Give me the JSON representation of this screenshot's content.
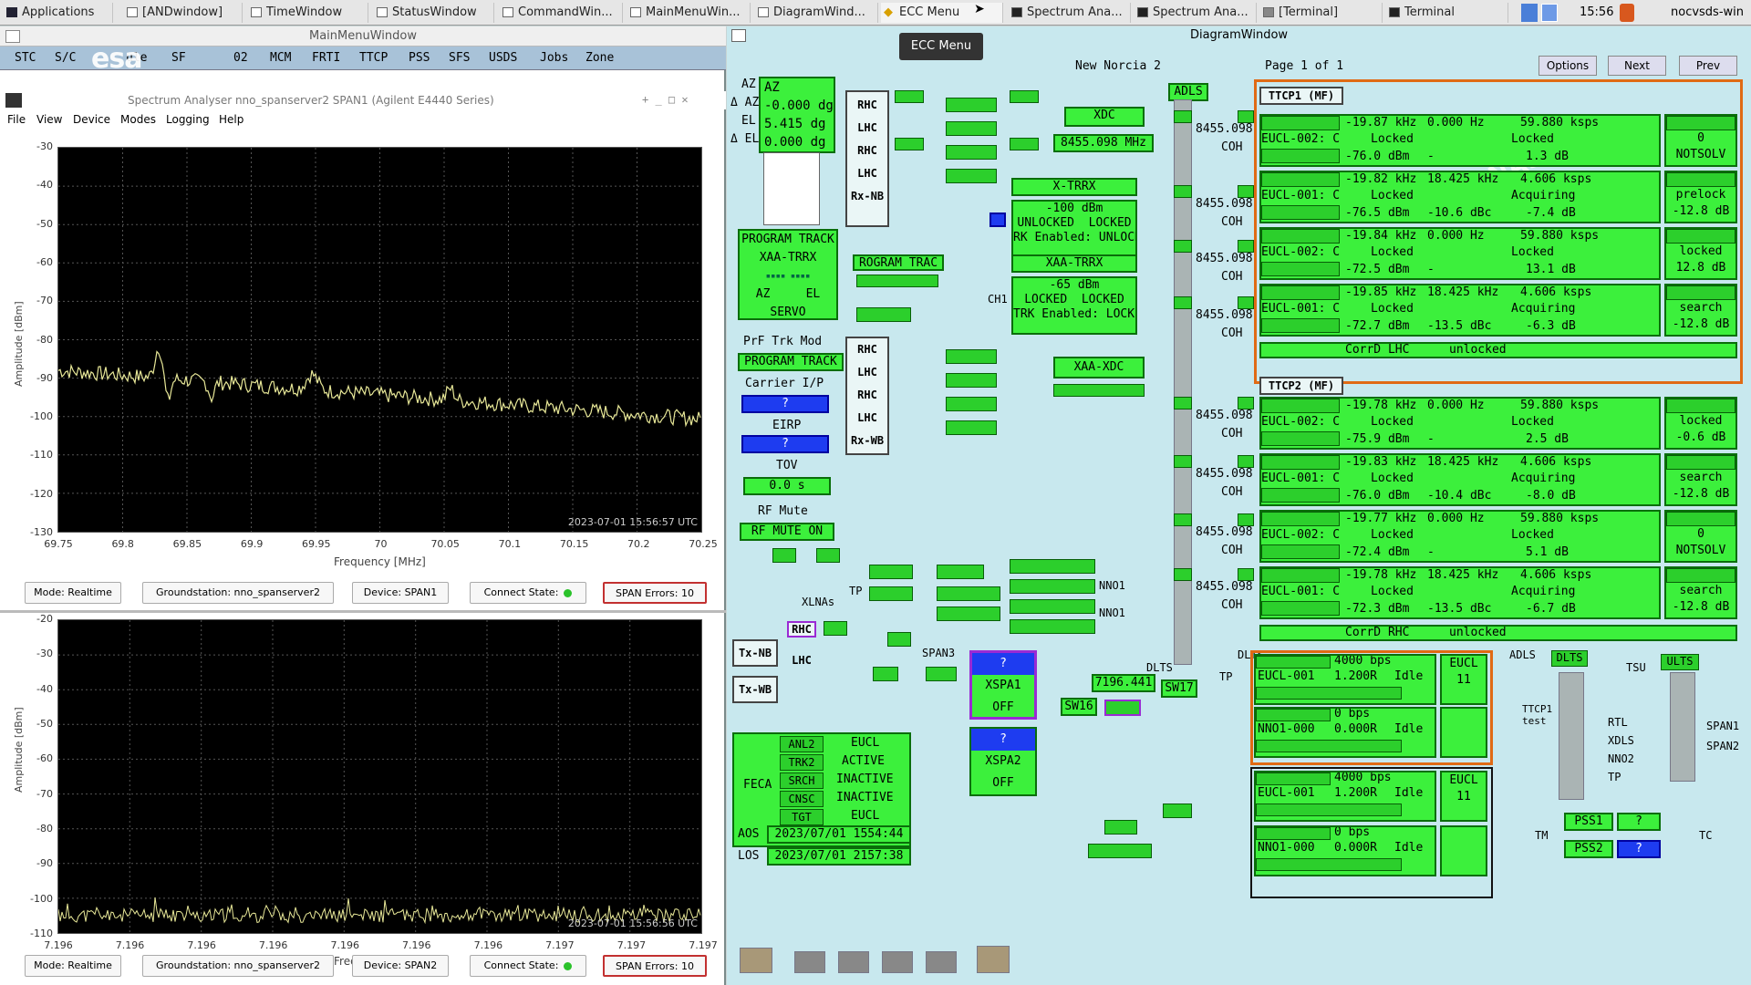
{
  "taskbar": {
    "items": [
      "Applications",
      "[ANDwindow]",
      "TimeWindow",
      "StatusWindow",
      "CommandWin...",
      "MainMenuWin...",
      "DiagramWind...",
      "ECC Menu",
      "Spectrum Ana...",
      "Spectrum Ana...",
      "[Terminal]",
      "Terminal"
    ],
    "clock": "15:56",
    "host": "nocvsds-win",
    "tooltip": "ECC Menu"
  },
  "mainmenu": {
    "title": "MainMenuWindow",
    "items": [
      "STC",
      "S/C",
      "ule",
      "SF",
      "02",
      "MCM",
      "FRTI",
      "TTCP",
      "PSS",
      "SFS",
      "USDS",
      "Jobs",
      "Zone"
    ],
    "logo": "esa"
  },
  "spectrum": {
    "title": "Spectrum Analyser nno_spanserver2 SPAN1 (Agilent E4440 Series)",
    "menu": [
      "File",
      "View",
      "Device",
      "Modes",
      "Logging",
      "Help"
    ],
    "plot1": {
      "ylabel": "Amplitude [dBm]",
      "yticks": [
        "-30",
        "-40",
        "-50",
        "-60",
        "-70",
        "-80",
        "-90",
        "-100",
        "-110",
        "-120",
        "-130"
      ],
      "xticks": [
        "69.75",
        "69.8",
        "69.85",
        "69.9",
        "69.95",
        "70",
        "70.05",
        "70.1",
        "70.15",
        "70.2",
        "70.25"
      ],
      "xlabel": "Frequency [MHz]",
      "timestamp": "2023-07-01 15:56:57 UTC"
    },
    "status1": {
      "mode": "Mode: Realtime",
      "gs": "Groundstation: nno_spanserver2",
      "device": "Device: SPAN1",
      "connect": "Connect State:",
      "errors": "SPAN Errors: 10"
    },
    "plot2": {
      "ylabel": "Amplitude [dBm]",
      "yticks": [
        "-20",
        "-30",
        "-40",
        "-50",
        "-60",
        "-70",
        "-80",
        "-90",
        "-100",
        "-110"
      ],
      "xticks": [
        "7.196",
        "7.196",
        "7.196",
        "7.196",
        "7.196",
        "7.196",
        "7.196",
        "7.197",
        "7.197",
        "7.197"
      ],
      "xlabel": "Frequency [GHz]",
      "timestamp": "2023-07-01 15:56:56 UTC"
    },
    "status2": {
      "mode": "Mode: Realtime",
      "gs": "Groundstation: nno_spanserver2",
      "device": "Device: SPAN2",
      "connect": "Connect State:",
      "errors": "SPAN Errors: 10"
    }
  },
  "diagram": {
    "title": "DiagramWindow",
    "station": "New Norcia 2",
    "page": "Page 1 of 1",
    "options": "Options",
    "next": "Next",
    "prev": "Prev",
    "az_lbl": "AZ",
    "az": "AZ",
    "daz_lbl": "Δ AZ",
    "daz": "-0.000 dg",
    "el_lbl": "EL",
    "el": "5.415 dg",
    "del_lbl": "Δ EL",
    "del": "0.000 dg",
    "rhc": "RHC",
    "lhc": "LHC",
    "rxnb": "Rx-NB",
    "rxwb": "Rx-WB",
    "xdc": "XDC",
    "xdc_freq": "8455.098 MHz",
    "xtrrx": "X-TRRX",
    "xtrrx_lvl": "-100 dBm",
    "unlocked": "UNLOCKED",
    "locked": "LOCKED",
    "rk_en": "RK Enabled: UNLOCK",
    "xaatrrx": "XAA-TRRX",
    "xaa_lvl": "-65 dBm",
    "trk_en": "TRK Enabled: LOCKED",
    "ch1": "CH1",
    "adls": "ADLS",
    "xaaxdc": "XAA-XDC",
    "prog_track": "PROGRAM TRACK",
    "xaa_trrx2": "XAA-TRRX",
    "rog_trac": "ROGRAM TRAC",
    "servo": "SERVO",
    "el2": "EL",
    "prf": "PrF Trk Mod",
    "prog_track2": "PROGRAM TRACK",
    "carrier": "Carrier I/P",
    "q": "?",
    "eirp": "EIRP",
    "tov": "TOV",
    "tov_val": "0.0 s",
    "rfmute": "RF Mute",
    "rfmute_on": "RF MUTE ON",
    "xlnas": "XLNAs",
    "tp": "TP",
    "txnb": "Tx-NB",
    "txwb": "Tx-WB",
    "span3": "SPAN3",
    "xspa1": "XSPA1",
    "xspa2": "XSPA2",
    "off": "OFF",
    "sw16": "SW16",
    "sw17": "SW17",
    "f7196": "7196.441",
    "dlts": "DLTS",
    "nno1": "NNO1",
    "feca": "FECA",
    "anl2": "ANL2",
    "trk2": "TRK2",
    "srch": "SRCH",
    "cnsc": "CNSC",
    "tgt": "TGT",
    "eucl": "EUCL",
    "active": "ACTIVE",
    "inactive": "INACTIVE",
    "aos_lbl": "AOS",
    "aos": "2023/07/01 1554:44",
    "los_lbl": "LOS",
    "los": "2023/07/01 2157:38",
    "coh": "COH",
    "f8455": "8455.098",
    "ttcp1": "TTCP1 (MF)",
    "ttcp2": "TTCP2 (MF)",
    "rows": [
      [
        "-19.87 kHz",
        "0.000 Hz",
        "59.880 ksps",
        "EUCL-002: C",
        "Locked",
        "Locked",
        "-76.0 dBm",
        "-",
        "1.3 dB",
        "0",
        "NOTSOLV"
      ],
      [
        "-19.82 kHz",
        "18.425 kHz",
        "4.606 ksps",
        "EUCL-001: C",
        "Locked",
        "Acquiring",
        "-76.5 dBm",
        "-10.6 dBc",
        "-7.4 dB",
        "prelock",
        "-12.8 dB"
      ],
      [
        "-19.84 kHz",
        "0.000 Hz",
        "59.880 ksps",
        "EUCL-002: C",
        "Locked",
        "Locked",
        "-72.5 dBm",
        "-",
        "13.1 dB",
        "locked",
        "12.8 dB"
      ],
      [
        "-19.85 kHz",
        "18.425 kHz",
        "4.606 ksps",
        "EUCL-001: C",
        "Locked",
        "Acquiring",
        "-72.7 dBm",
        "-13.5 dBc",
        "-6.3 dB",
        "search",
        "-12.8 dB"
      ],
      [
        "-19.78 kHz",
        "0.000 Hz",
        "59.880 ksps",
        "EUCL-002: C",
        "Locked",
        "Locked",
        "-75.9 dBm",
        "-",
        "2.5 dB",
        "locked",
        "-0.6 dB"
      ],
      [
        "-19.83 kHz",
        "18.425 kHz",
        "4.606 ksps",
        "EUCL-001: C",
        "Locked",
        "Acquiring",
        "-76.0 dBm",
        "-10.4 dBc",
        "-8.0 dB",
        "search",
        "-12.8 dB"
      ],
      [
        "-19.77 kHz",
        "0.000 Hz",
        "59.880 ksps",
        "EUCL-002: C",
        "Locked",
        "Locked",
        "-72.4 dBm",
        "-",
        "5.1 dB",
        "0",
        "NOTSOLV"
      ],
      [
        "-19.78 kHz",
        "18.425 kHz",
        "4.606 ksps",
        "EUCL-001: C",
        "Locked",
        "Acquiring",
        "-72.3 dBm",
        "-13.5 dBc",
        "-6.7 dB",
        "search",
        "-12.8 dB"
      ]
    ],
    "corrlhc": "CorrD LHC",
    "corrrhc": "CorrD RHC",
    "unlocked2": "unlocked",
    "tm": [
      {
        "rate": "4000 bps",
        "name": "EUCL-001",
        "bw": "1.200R",
        "st": "Idle",
        "eucl": "EUCL",
        "n": "11"
      },
      {
        "rate": "0 bps",
        "name": "NNO1-000",
        "bw": "0.000R",
        "st": "Idle"
      },
      {
        "rate": "4000 bps",
        "name": "EUCL-001",
        "bw": "1.200R",
        "st": "Idle",
        "eucl": "EUCL",
        "n": "11"
      },
      {
        "rate": "0 bps",
        "name": "NNO1-000",
        "bw": "0.000R",
        "st": "Idle"
      }
    ],
    "pss1": "PSS1",
    "pss2": "PSS2",
    "tc": "TC",
    "tm2": "TM",
    "tsu": "TSU",
    "ultslbl": "ULTS",
    "dltslbl": "DLTS",
    "rtl": "RTL",
    "xdls": "XDLS",
    "nno2": "NNO2",
    "span1": "SPAN1",
    "span2": "SPAN2",
    "tcp": "TTCP1 test"
  }
}
